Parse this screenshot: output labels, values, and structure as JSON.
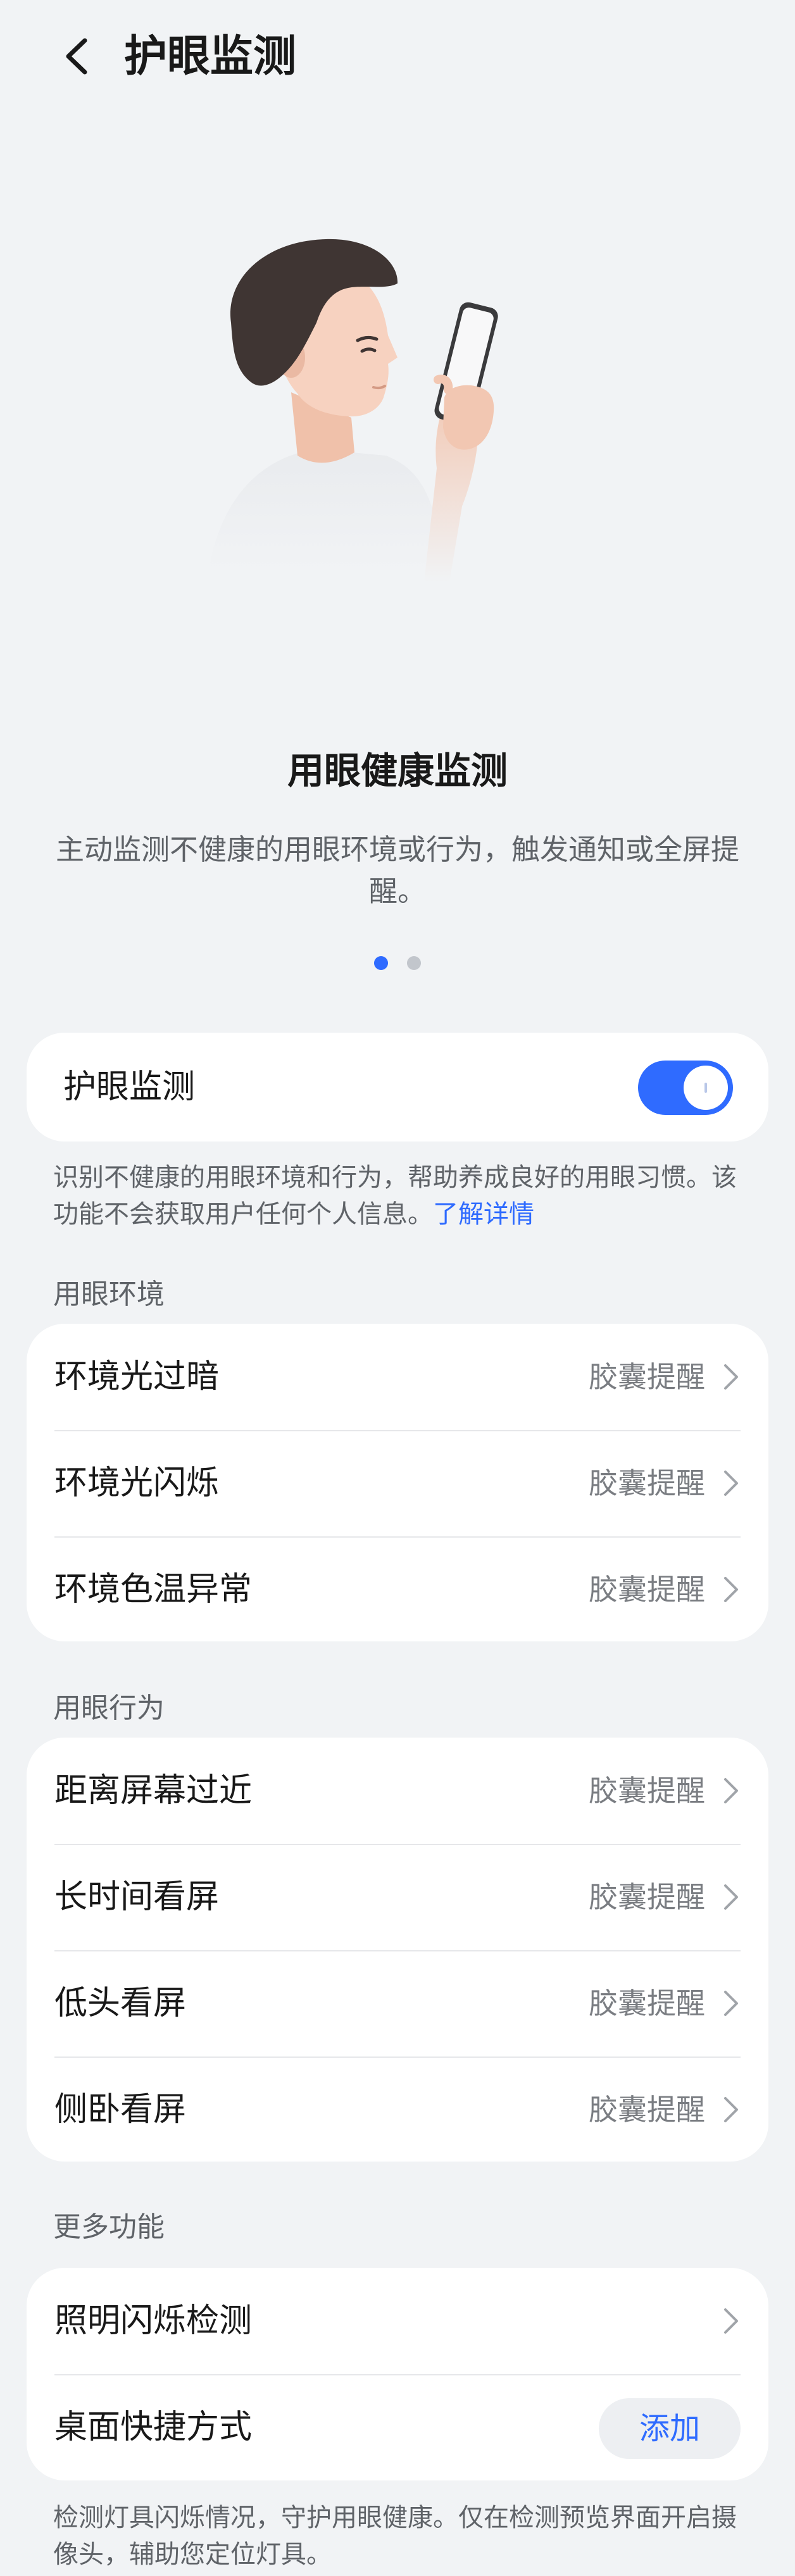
{
  "header": {
    "title": "护眼监测"
  },
  "hero": {
    "title": "用眼健康监测",
    "description": "主动监测不健康的用眼环境或行为，触发通知或全屏提醒。",
    "page_count": 2,
    "active_page": 1
  },
  "main_toggle": {
    "label": "护眼监测",
    "enabled": true
  },
  "main_note": {
    "text": "识别不健康的用眼环境和行为，帮助养成良好的用眼习惯。该功能不会获取用户任何个人信息。",
    "link": "了解详情"
  },
  "environment": {
    "title": "用眼环境",
    "items": [
      {
        "label": "环境光过暗",
        "value": "胶囊提醒"
      },
      {
        "label": "环境光闪烁",
        "value": "胶囊提醒"
      },
      {
        "label": "环境色温异常",
        "value": "胶囊提醒"
      }
    ]
  },
  "behavior": {
    "title": "用眼行为",
    "items": [
      {
        "label": "距离屏幕过近",
        "value": "胶囊提醒"
      },
      {
        "label": "长时间看屏",
        "value": "胶囊提醒"
      },
      {
        "label": "低头看屏",
        "value": "胶囊提醒"
      },
      {
        "label": "侧卧看屏",
        "value": "胶囊提醒"
      }
    ]
  },
  "more": {
    "title": "更多功能",
    "flicker_label": "照明闪烁检测",
    "shortcut_label": "桌面快捷方式",
    "add_label": "添加",
    "note": "检测灯具闪烁情况，守护用眼健康。仅在检测预览界面开启摄像头，辅助您定位灯具。"
  },
  "colors": {
    "accent": "#2f6bff",
    "background": "#f1f3f5",
    "card": "#ffffff"
  }
}
